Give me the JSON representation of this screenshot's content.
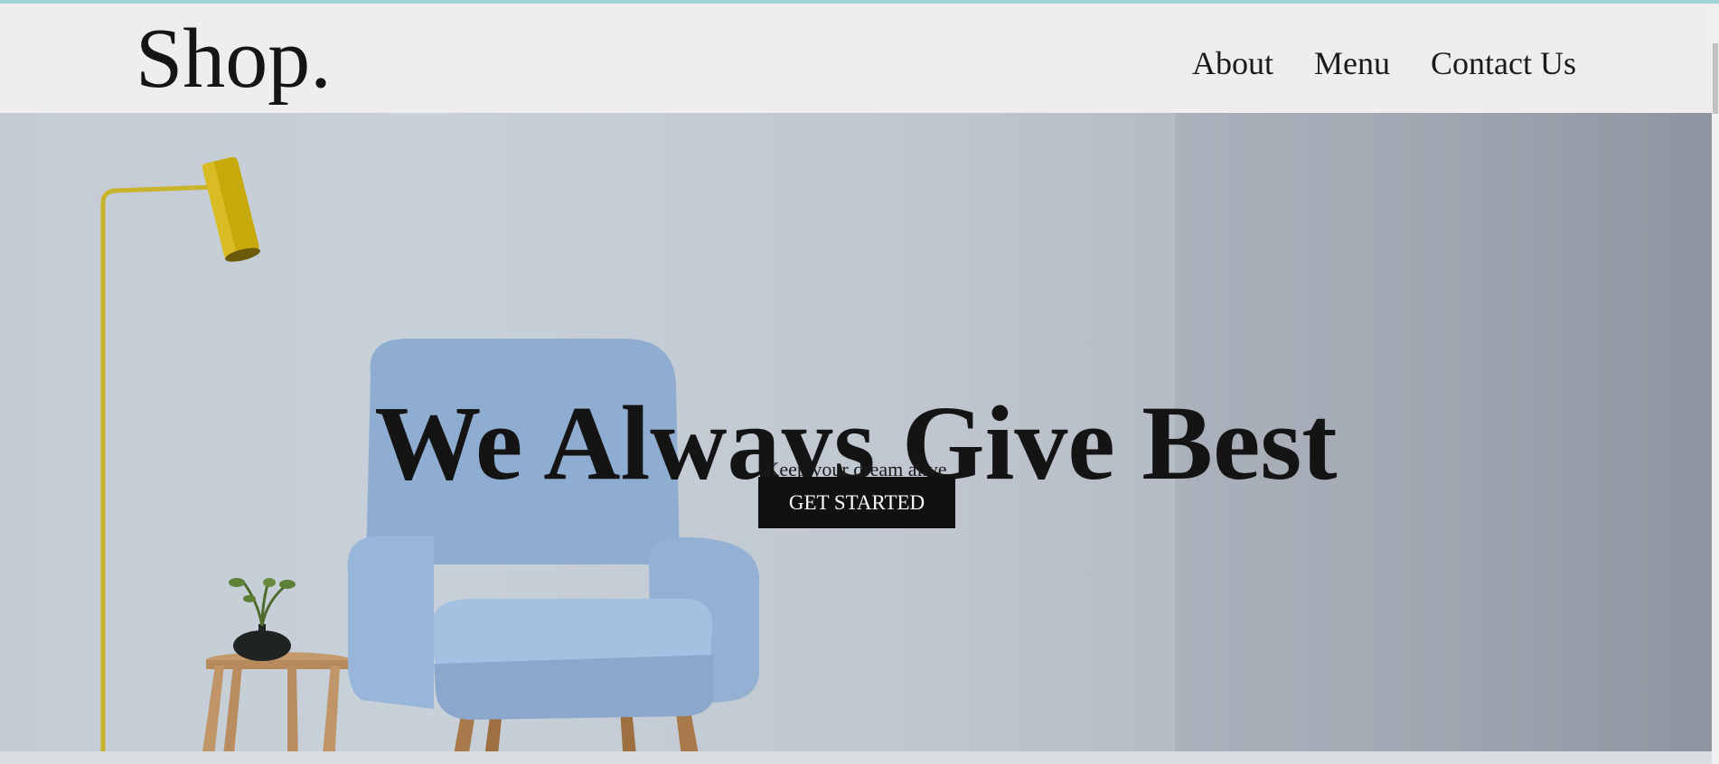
{
  "header": {
    "logo": "Shop.",
    "nav": [
      "About",
      "Menu",
      "Contact Us"
    ]
  },
  "hero": {
    "title": "We Always Give Best",
    "subtitle": "Keep your dream alive",
    "cta_label": "GET STARTED"
  },
  "colors": {
    "accent_strip": "#9fd3d6",
    "navbar_bg": "#efeeec",
    "button_bg": "#111111",
    "button_text": "#ffffff"
  }
}
